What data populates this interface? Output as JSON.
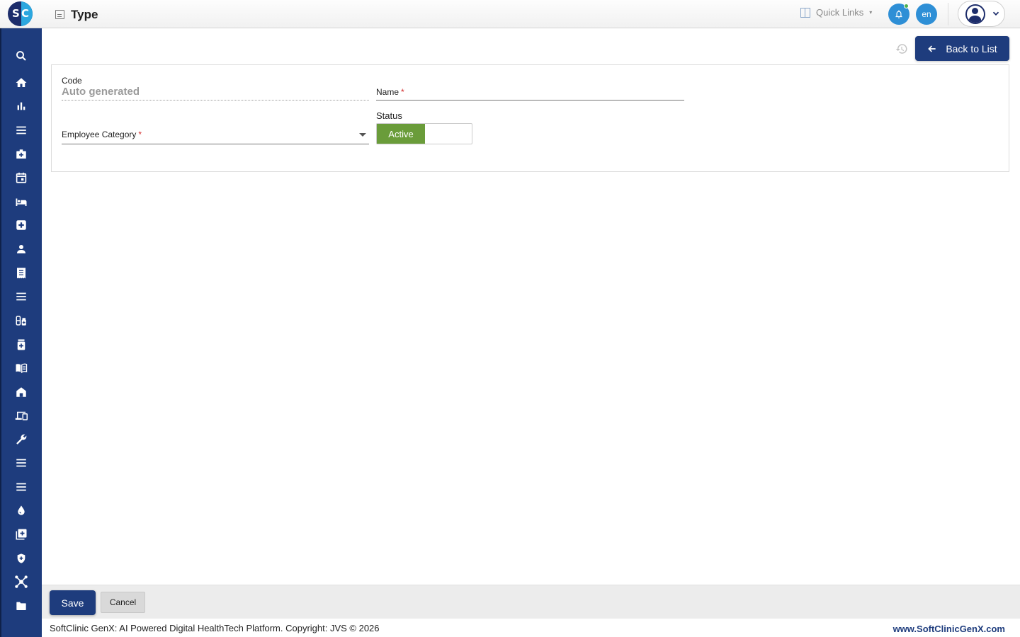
{
  "header": {
    "logo_letters": [
      "S",
      "C"
    ],
    "title": "Type",
    "quick_links_label": "Quick Links",
    "language": "en"
  },
  "sidebar": {
    "icons": [
      "search-icon",
      "home-icon",
      "bar-chart-icon",
      "menu-icon",
      "medical-bag-icon",
      "calendar-icon",
      "bed-icon",
      "medical-plus-icon",
      "person-icon",
      "receipt-icon",
      "list-icon",
      "pharmacy-icon",
      "medicine-bottle-icon",
      "book-icon",
      "store-icon",
      "devices-icon",
      "wrench-icon",
      "lines-icon",
      "menu-alt-icon",
      "blood-drop-icon",
      "add-box-icon",
      "shield-plus-icon",
      "network-icon",
      "folder-icon"
    ]
  },
  "toolbar": {
    "back_label": "Back to List"
  },
  "form": {
    "code_label": "Code",
    "code_value": "Auto generated",
    "name_label": "Name",
    "name_required": "*",
    "employee_category_label": "Employee Category",
    "employee_category_required": "*",
    "status_label": "Status",
    "status_value": "Active"
  },
  "actions": {
    "save_label": "Save",
    "cancel_label": "Cancel"
  },
  "footer": {
    "copyright": "SoftClinic GenX: AI Powered Digital HealthTech Platform. Copyright: JVS © 2026",
    "website": "www.SoftClinicGenX.com"
  },
  "colors": {
    "primary": "#1e3c7d",
    "accent": "#2e8fd6",
    "active_green": "#6a9c3a",
    "required_red": "#d32f2f"
  }
}
